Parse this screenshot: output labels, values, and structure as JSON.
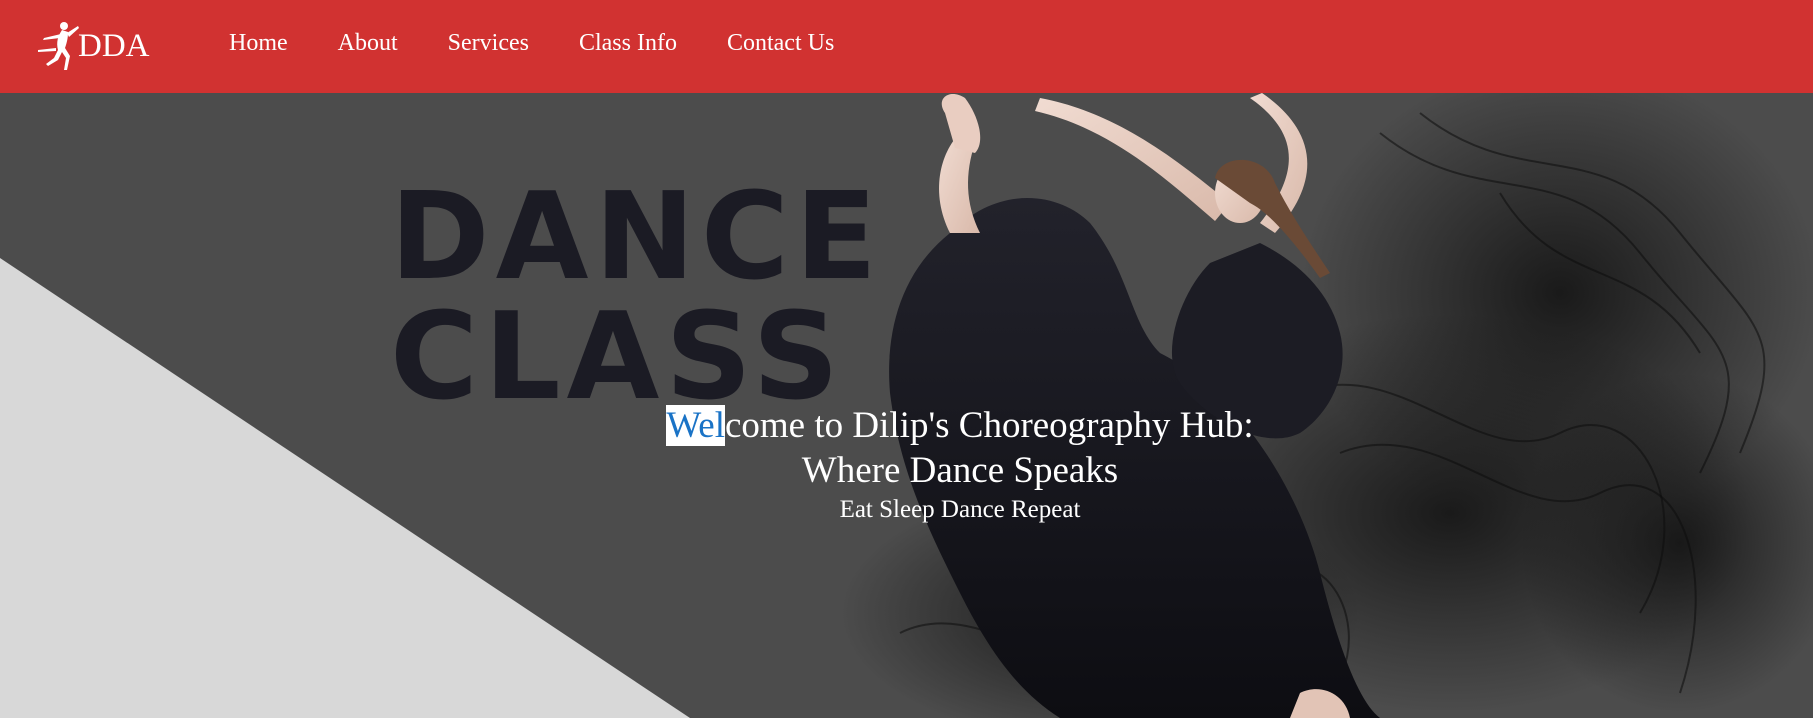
{
  "brand": {
    "logo_text": "DDA",
    "color": "#d13231"
  },
  "nav": {
    "items": [
      {
        "label": "Home"
      },
      {
        "label": "About"
      },
      {
        "label": "Services"
      },
      {
        "label": "Class Info"
      },
      {
        "label": "Contact Us"
      }
    ]
  },
  "hero": {
    "artwork_word_1": "DANCE",
    "artwork_word_2": "CLASS",
    "title_selected": "Wel",
    "title_rest": "come to Dilip's Choreography Hub:",
    "title_line2": "Where Dance Speaks",
    "subtitle": "Eat Sleep Dance Repeat",
    "selection_color": "#1a73c6"
  },
  "icons": {
    "logo": "dancer-silhouette-icon"
  }
}
